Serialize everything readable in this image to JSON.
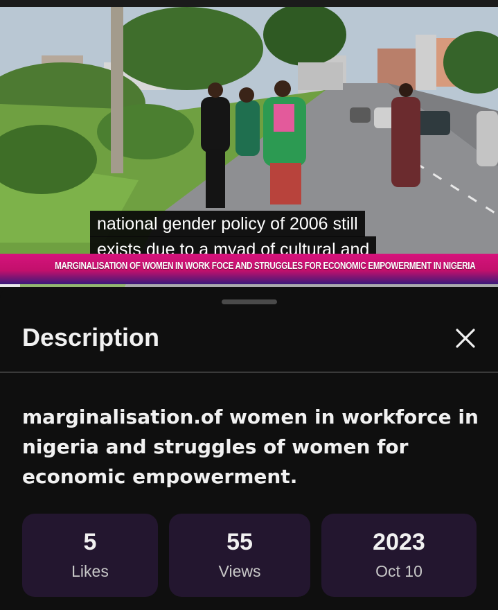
{
  "video": {
    "caption_lines": [
      "national gender policy of 2006 still",
      "exists due to a myad of cultural and"
    ],
    "ticker_text": "MARGINALISATION OF WOMEN IN WORK FOCE AND STRUGGLES FOR ECONOMIC EMPOWERMENT IN NIGERIA",
    "progress_fraction": 0.04,
    "ticker_color": "#d6137c"
  },
  "sheet": {
    "title": "Description",
    "close_icon": "close-icon",
    "description": "marginalisation.of women in workforce in nigeria and struggles of women for economic empowerment.",
    "stats": [
      {
        "value": "5",
        "label": "Likes"
      },
      {
        "value": "55",
        "label": "Views"
      },
      {
        "value": "2023",
        "label": "Oct 10"
      }
    ],
    "stat_bg_color": "#23162f"
  }
}
